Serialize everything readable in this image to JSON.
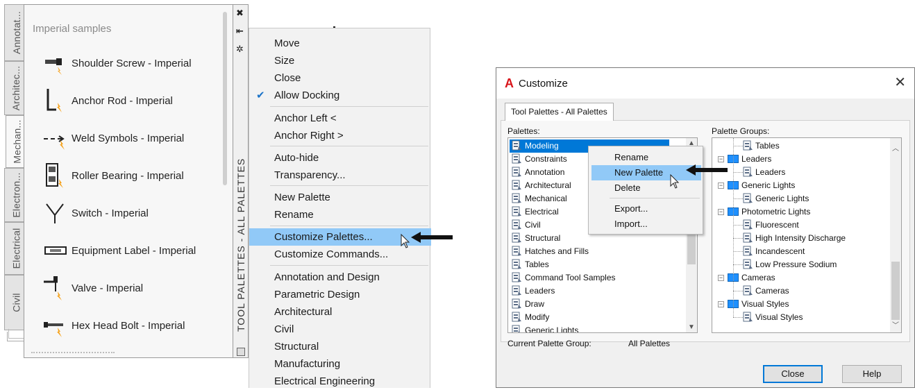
{
  "palette": {
    "tabs": [
      "Annotat...",
      "Architec...",
      "Mechan...",
      "Electron...",
      "Electrical",
      "Civil"
    ],
    "active_tab_index": 2,
    "title": "Imperial samples",
    "items": [
      {
        "label": "Shoulder Screw - Imperial",
        "icon": "shoulder-screw-icon"
      },
      {
        "label": "Anchor Rod - Imperial",
        "icon": "anchor-rod-icon"
      },
      {
        "label": "Weld Symbols - Imperial",
        "icon": "weld-symbols-icon"
      },
      {
        "label": "Roller Bearing - Imperial",
        "icon": "roller-bearing-icon"
      },
      {
        "label": "Switch - Imperial",
        "icon": "switch-icon"
      },
      {
        "label": "Equipment Label - Imperial",
        "icon": "equipment-label-icon"
      },
      {
        "label": "Valve - Imperial",
        "icon": "valve-icon"
      },
      {
        "label": "Hex Head Bolt - Imperial",
        "icon": "hex-head-bolt-icon"
      }
    ],
    "strip_title": "TOOL PALETTES - ALL PALETTES"
  },
  "context_menu": {
    "items": [
      "Move",
      "Size",
      "Close",
      "Allow Docking",
      "Anchor Left  <",
      "Anchor Right  >",
      "Auto-hide",
      "Transparency...",
      "New Palette",
      "Rename",
      "Customize Palettes...",
      "Customize Commands...",
      "Annotation and Design",
      "Parametric Design",
      "Architectural",
      "Civil",
      "Structural",
      "Manufacturing",
      "Electrical Engineering"
    ],
    "checked_item": "Allow Docking",
    "highlighted_item": "Customize Palettes..."
  },
  "dialog": {
    "title": "Customize",
    "tab": "Tool Palettes - All Palettes",
    "palettes_label": "Palettes:",
    "palette_groups_label": "Palette Groups:",
    "palettes": [
      "Modeling",
      "Constraints",
      "Annotation",
      "Architectural",
      "Mechanical",
      "Electrical",
      "Civil",
      "Structural",
      "Hatches and Fills",
      "Tables",
      "Command Tool Samples",
      "Leaders",
      "Draw",
      "Modify",
      "Generic Lights"
    ],
    "selected_palette": "Modeling",
    "groups_tree": [
      {
        "label": "Tables",
        "level": 2,
        "kind": "palette"
      },
      {
        "label": "Leaders",
        "level": 1,
        "kind": "group"
      },
      {
        "label": "Leaders",
        "level": 2,
        "kind": "palette"
      },
      {
        "label": "Generic Lights",
        "level": 1,
        "kind": "group"
      },
      {
        "label": "Generic Lights",
        "level": 2,
        "kind": "palette"
      },
      {
        "label": "Photometric Lights",
        "level": 1,
        "kind": "group"
      },
      {
        "label": "Fluorescent",
        "level": 2,
        "kind": "palette"
      },
      {
        "label": "High Intensity Discharge",
        "level": 2,
        "kind": "palette"
      },
      {
        "label": "Incandescent",
        "level": 2,
        "kind": "palette"
      },
      {
        "label": "Low Pressure Sodium",
        "level": 2,
        "kind": "palette"
      },
      {
        "label": "Cameras",
        "level": 1,
        "kind": "group"
      },
      {
        "label": "Cameras",
        "level": 2,
        "kind": "palette"
      },
      {
        "label": "Visual Styles",
        "level": 1,
        "kind": "group"
      },
      {
        "label": "Visual Styles",
        "level": 2,
        "kind": "palette"
      }
    ],
    "current_group_label": "Current Palette Group:",
    "current_group_value": "All Palettes",
    "inner_menu": {
      "items": [
        "Rename",
        "New Palette",
        "Delete",
        "Export...",
        "Import..."
      ],
      "highlighted_item": "New Palette"
    },
    "buttons": {
      "close": "Close",
      "help": "Help"
    }
  },
  "colors": {
    "menu_highlight": "#91c9f7",
    "selection": "#0078d7",
    "autocad_red": "#d8141a",
    "folder_blue": "#1e90ff"
  }
}
